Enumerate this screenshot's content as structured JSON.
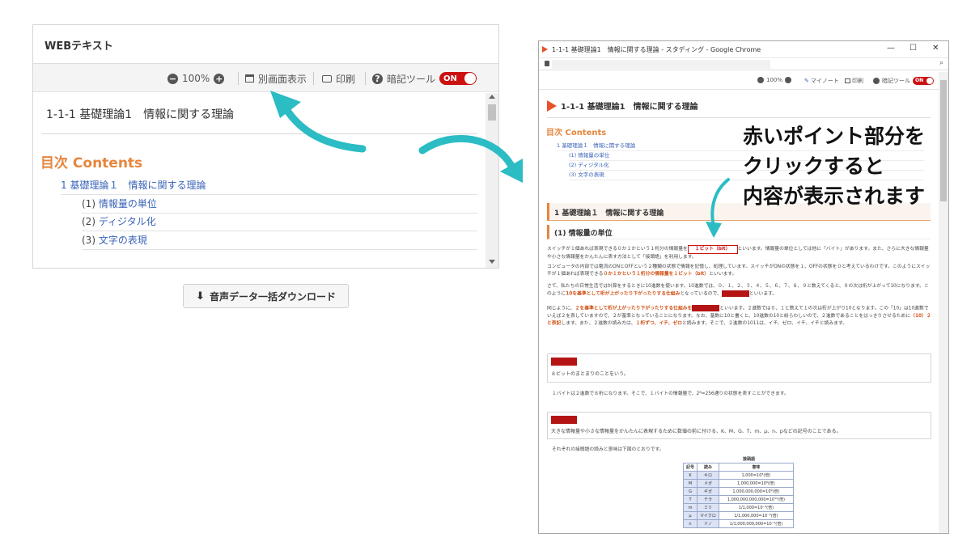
{
  "left_panel": {
    "header": "WEBテキスト",
    "toolbar": {
      "zoom": "100%",
      "separate_window": "別画面表示",
      "print": "印刷",
      "memorize_tool": "暗記ツール",
      "toggle_state": "ON"
    },
    "doc_title": "1-1-1 基礎理論1　情報に関する理論",
    "toc_heading": "目次 Contents",
    "toc": [
      {
        "num": "",
        "label": "1 基礎理論１　情報に関する理論"
      },
      {
        "num": "(1)",
        "label": "情報量の単位"
      },
      {
        "num": "(2)",
        "label": "ディジタル化"
      },
      {
        "num": "(3)",
        "label": "文字の表現"
      }
    ]
  },
  "download_button": "音声データ一括ダウンロード",
  "browser": {
    "window_title": "1-1-1 基礎理論1　情報に関する理論 - スタディング - Google Chrome",
    "toolbar": {
      "zoom": "100%",
      "my_note": "マイノート",
      "print": "印刷",
      "memorize_tool": "暗記ツール",
      "toggle_state": "ON"
    },
    "doc_title": "1-1-1 基礎理論1　情報に関する理論",
    "toc_heading": "目次 Contents",
    "toc": [
      "1 基礎理論１　情報に関する理論",
      "(1) 情報量の単位",
      "(2) ディジタル化",
      "(3) 文字の表現"
    ],
    "section_heading": "1 基礎理論１　情報に関する理論",
    "subsection_heading": "(1) 情報量の単位",
    "p1_a": "スイッチが１個あれば表現できる０か１かという１桁分の情報量を",
    "p1_box": "１ビット（bit）",
    "p1_b": "といいます。情報量の単位としては他に「バイト」があります。また、さらに大きな情報量や小さな情報量をかんたんに表す方法として「接頭語」を利用します。",
    "p2_a": "コンピュータの内部では電流のONとOFFという２種類の状態で情報を記憶し、処理しています。スイッチがONの状態を１、OFFの状態を０と考えているわけです。このようにスイッチが１個あれば表現できる",
    "p2_hl": "０か１かという１桁分の情報量を１ビット（bit）",
    "p2_b": "といいます。",
    "p3_a": "さて、私たちの日常生活では計算をするときに10進数を使います。10進数では、０、１、２、３、４、５、６、７、８、９と数えてくると、９の次は桁が上がって10になります。このように",
    "p3_hl": "10を基準として桁が上がったり下がったりする仕組み",
    "p3_b": "となっているので、",
    "p3_c": "といいます。",
    "p4_a": "同じように、",
    "p4_hl": "２を基準として桁が上がったり下がったりする仕組みを",
    "p4_b": "といいます。２進数では０、１と数えて１の次は桁が上がり10となります。この「10」は10進数でいえば２を表していますので、２が基準となっていることになります。なお、基数に10と書くと、10進数の10と紛らわしいので、２進数であることをはっきりさせるために",
    "p4_hl2": "（10）２と表記",
    "p4_c": "します。また、２進数の読み方は、",
    "p4_hl3": "１桁ずつ、イチ、ゼロ",
    "p4_d": "と読みます。そこで、２進数の1011は、イチ、ゼロ、イチ、イチと読みます。",
    "card1_text": "８ビットのまとまりのことをいう。",
    "p5": "１バイトは２進数で８桁になります。そこで、１バイトの情報量で、2⁸=256通りの状態を表すことができます。",
    "card2_text": "大きな情報量や小さな情報量をかんたんに表現するために数値の前に付ける、K、M、G、T、m、μ、n、pなどの記号のことである。",
    "p6": "それぞれの接頭語の読みと意味は下図のとおりです。",
    "table": {
      "caption": "接頭語",
      "headers": [
        "記号",
        "読み",
        "意味"
      ],
      "rows": [
        [
          "K",
          "キロ",
          "1,000=10³(倍)"
        ],
        [
          "M",
          "メガ",
          "1,000,000=10⁶(倍)"
        ],
        [
          "G",
          "ギガ",
          "1,000,000,000=10⁹(倍)"
        ],
        [
          "T",
          "テラ",
          "1,000,000,000,000=10¹²(倍)"
        ],
        [
          "m",
          "ミリ",
          "1/1,000=10⁻³(倍)"
        ],
        [
          "μ",
          "マイクロ",
          "1/1,000,000=10⁻⁶(倍)"
        ],
        [
          "n",
          "ナノ",
          "1/1,000,000,000=10⁻⁹(倍)"
        ]
      ]
    }
  },
  "annotation": {
    "line1": "赤いポイント部分を",
    "line2": "クリックすると",
    "line3": "内容が表示されます"
  },
  "colors": {
    "accent_orange": "#e6853d",
    "link_blue": "#3a63b8",
    "toggle_red": "#cc1111",
    "arrow_teal": "#2bbcc4"
  }
}
